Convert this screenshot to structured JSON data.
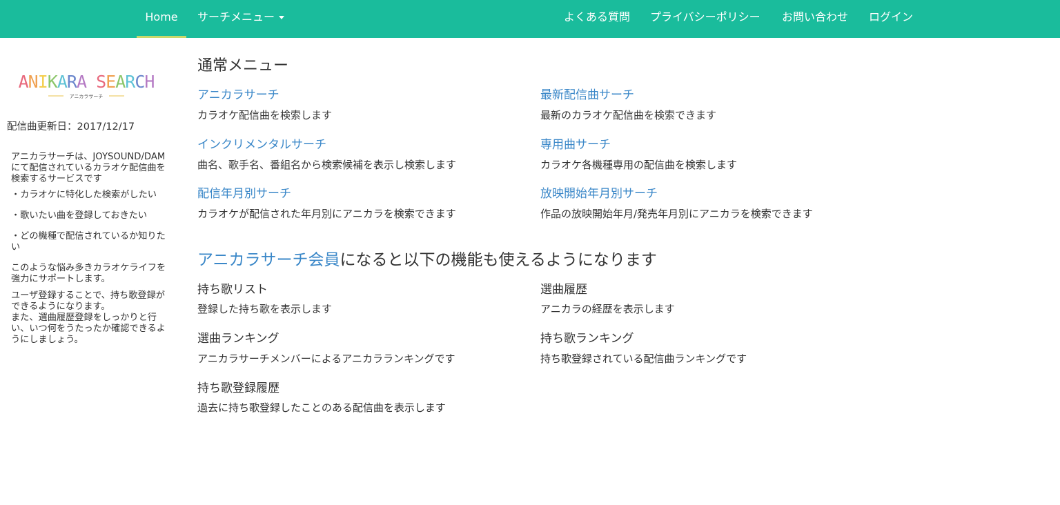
{
  "nav": {
    "home": "Home",
    "search_menu": "サーチメニュー",
    "right": [
      "よくある質問",
      "プライバシーポリシー",
      "お問い合わせ",
      "ログイン"
    ]
  },
  "sidebar": {
    "logo": {
      "text": "ANIKARA SEARCH",
      "sub": "アニカラサーチ",
      "colors": [
        "#e8697d",
        "#f0a150",
        "#f4cf4f",
        "#8cc66b",
        "#5fc2d6",
        "#6a86cc",
        "#b57ac4",
        "#e8697d",
        "#f0a150",
        "#8cc66b",
        "#5fc2d6",
        "#6a86cc",
        "#b57ac4",
        "#e8697d"
      ]
    },
    "update_label": "配信曲更新日：2017/12/17",
    "description": "アニカラサーチは、JOYSOUND/DAMにて配信されているカラオケ配信曲を検索するサービスです",
    "bullets": [
      "・カラオケに特化した検索がしたい",
      "・歌いたい曲を登録しておきたい",
      "・どの機種で配信されているか知りたい"
    ],
    "support": "このような悩み多きカラオケライフを強力にサポートします。",
    "register": "ユーザ登録することで、持ち歌登録ができるようになります。",
    "history": "また、選曲履歴登録をしっかりと行い、いつ何をうたったか確認できるようにしましょう。"
  },
  "main": {
    "normal_menu_heading": "通常メニュー",
    "normal_items": [
      {
        "title": "アニカラサーチ",
        "desc": "カラオケ配信曲を検索します"
      },
      {
        "title": "最新配信曲サーチ",
        "desc": "最新のカラオケ配信曲を検索できます"
      },
      {
        "title": "インクリメンタルサーチ",
        "desc": "曲名、歌手名、番組名から検索候補を表示し検索します"
      },
      {
        "title": "専用曲サーチ",
        "desc": "カラオケ各機種専用の配信曲を検索します"
      },
      {
        "title": "配信年月別サーチ",
        "desc": "カラオケが配信された年月別にアニカラを検索できます"
      },
      {
        "title": "放映開始年月別サーチ",
        "desc": "作品の放映開始年月/発売年月別にアニカラを検索できます"
      }
    ],
    "member_link": "アニカラサーチ会員",
    "member_rest": "になると以下の機能も使えるようになります",
    "member_items": [
      {
        "title": "持ち歌リスト",
        "desc": "登録した持ち歌を表示します"
      },
      {
        "title": "選曲履歴",
        "desc": "アニカラの経歴を表示します"
      },
      {
        "title": "選曲ランキング",
        "desc": "アニカラサーチメンバーによるアニカラランキングです"
      },
      {
        "title": "持ち歌ランキング",
        "desc": "持ち歌登録されている配信曲ランキングです"
      },
      {
        "title": "持ち歌登録履歴",
        "desc": "過去に持ち歌登録したことのある配信曲を表示します"
      }
    ]
  },
  "colors": {
    "navbar": "#1abc9c",
    "link": "#3a87c8",
    "text": "#333333",
    "home_underline": "#c9d86a"
  }
}
